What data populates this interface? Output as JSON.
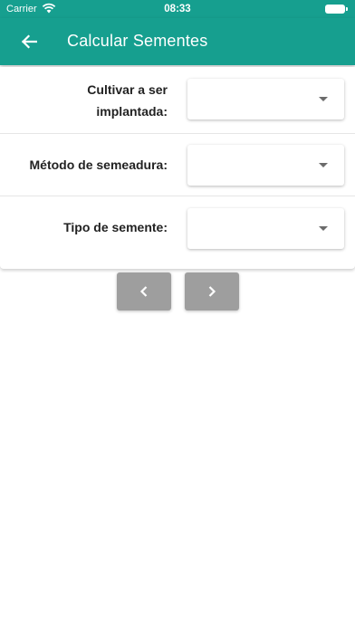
{
  "status_bar": {
    "carrier": "Carrier",
    "time": "08:33"
  },
  "app_bar": {
    "title": "Calcular Sementes",
    "back_icon": "arrow-left-icon"
  },
  "form": {
    "fields": [
      {
        "label": "Cultivar a ser implantada:",
        "value": ""
      },
      {
        "label": "Método de semeadura:",
        "value": ""
      },
      {
        "label": "Tipo de semente:",
        "value": ""
      }
    ]
  },
  "navigation": {
    "prev_icon": "chevron-left-icon",
    "next_icon": "chevron-right-icon"
  },
  "colors": {
    "primary": "#169f8f",
    "button_disabled": "#9e9e9e"
  }
}
